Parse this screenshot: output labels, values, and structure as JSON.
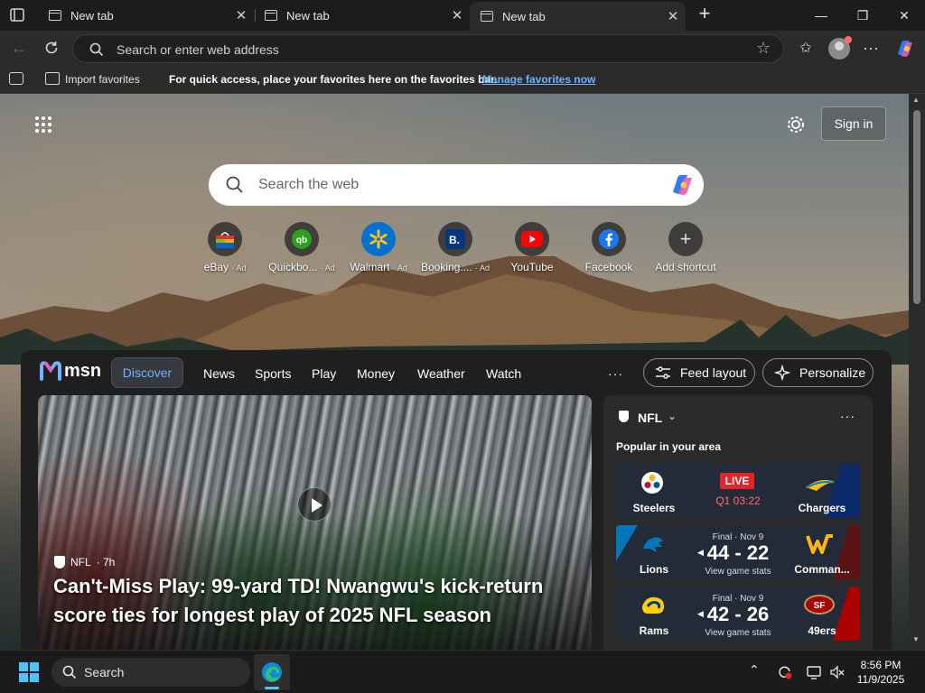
{
  "tabs": [
    {
      "label": "New tab",
      "active": false
    },
    {
      "label": "New tab",
      "active": false
    },
    {
      "label": "New tab",
      "active": true
    }
  ],
  "address_bar": {
    "placeholder": "Search or enter web address"
  },
  "favorites_bar": {
    "import_label": "Import favorites",
    "message": "For quick access, place your favorites here on the favorites bar.",
    "link": "Manage favorites now"
  },
  "newtab": {
    "signin_label": "Sign in",
    "search_placeholder": "Search the web",
    "shortcuts": [
      {
        "label": "eBay",
        "ad": "· Ad",
        "icon": "ebay-icon"
      },
      {
        "label": "Quickbo...",
        "ad": "· Ad",
        "icon": "quickbooks-icon"
      },
      {
        "label": "Walmart",
        "ad": "· Ad",
        "icon": "walmart-icon"
      },
      {
        "label": "Booking....",
        "ad": "· Ad",
        "icon": "booking-icon"
      },
      {
        "label": "YouTube",
        "ad": "",
        "icon": "youtube-icon"
      },
      {
        "label": "Facebook",
        "ad": "",
        "icon": "facebook-icon"
      },
      {
        "label": "Add shortcut",
        "ad": "",
        "icon": "plus-icon"
      }
    ]
  },
  "feed": {
    "brand": "msn",
    "nav": [
      "Discover",
      "News",
      "Sports",
      "Play",
      "Money",
      "Weather",
      "Watch"
    ],
    "more": "···",
    "feed_layout": "Feed layout",
    "personalize": "Personalize",
    "hero": {
      "source": "NFL",
      "age": "· 7h",
      "title": "Can't-Miss Play: 99-yard TD! Nwangwu's kick-return score ties for longest play of 2025 NFL season"
    },
    "nfl_card": {
      "title": "NFL",
      "subtitle": "Popular in your area",
      "games": [
        {
          "team1": "Steelers",
          "team2": "Chargers",
          "status": "LIVE",
          "detail": "Q1 03:22",
          "score": "",
          "stats": ""
        },
        {
          "team1": "Lions",
          "team2": "Comman...",
          "status": "Final · Nov 9",
          "detail": "",
          "score": "44 - 22",
          "stats": "View game stats"
        },
        {
          "team1": "Rams",
          "team2": "49ers",
          "status": "Final · Nov 9",
          "detail": "",
          "score": "42 - 26",
          "stats": "View game stats"
        }
      ]
    }
  },
  "taskbar": {
    "search_placeholder": "Search",
    "time": "8:56 PM",
    "date": "11/9/2025"
  },
  "colors": {
    "accent": "#6fb2ff",
    "live": "#e3242b"
  }
}
